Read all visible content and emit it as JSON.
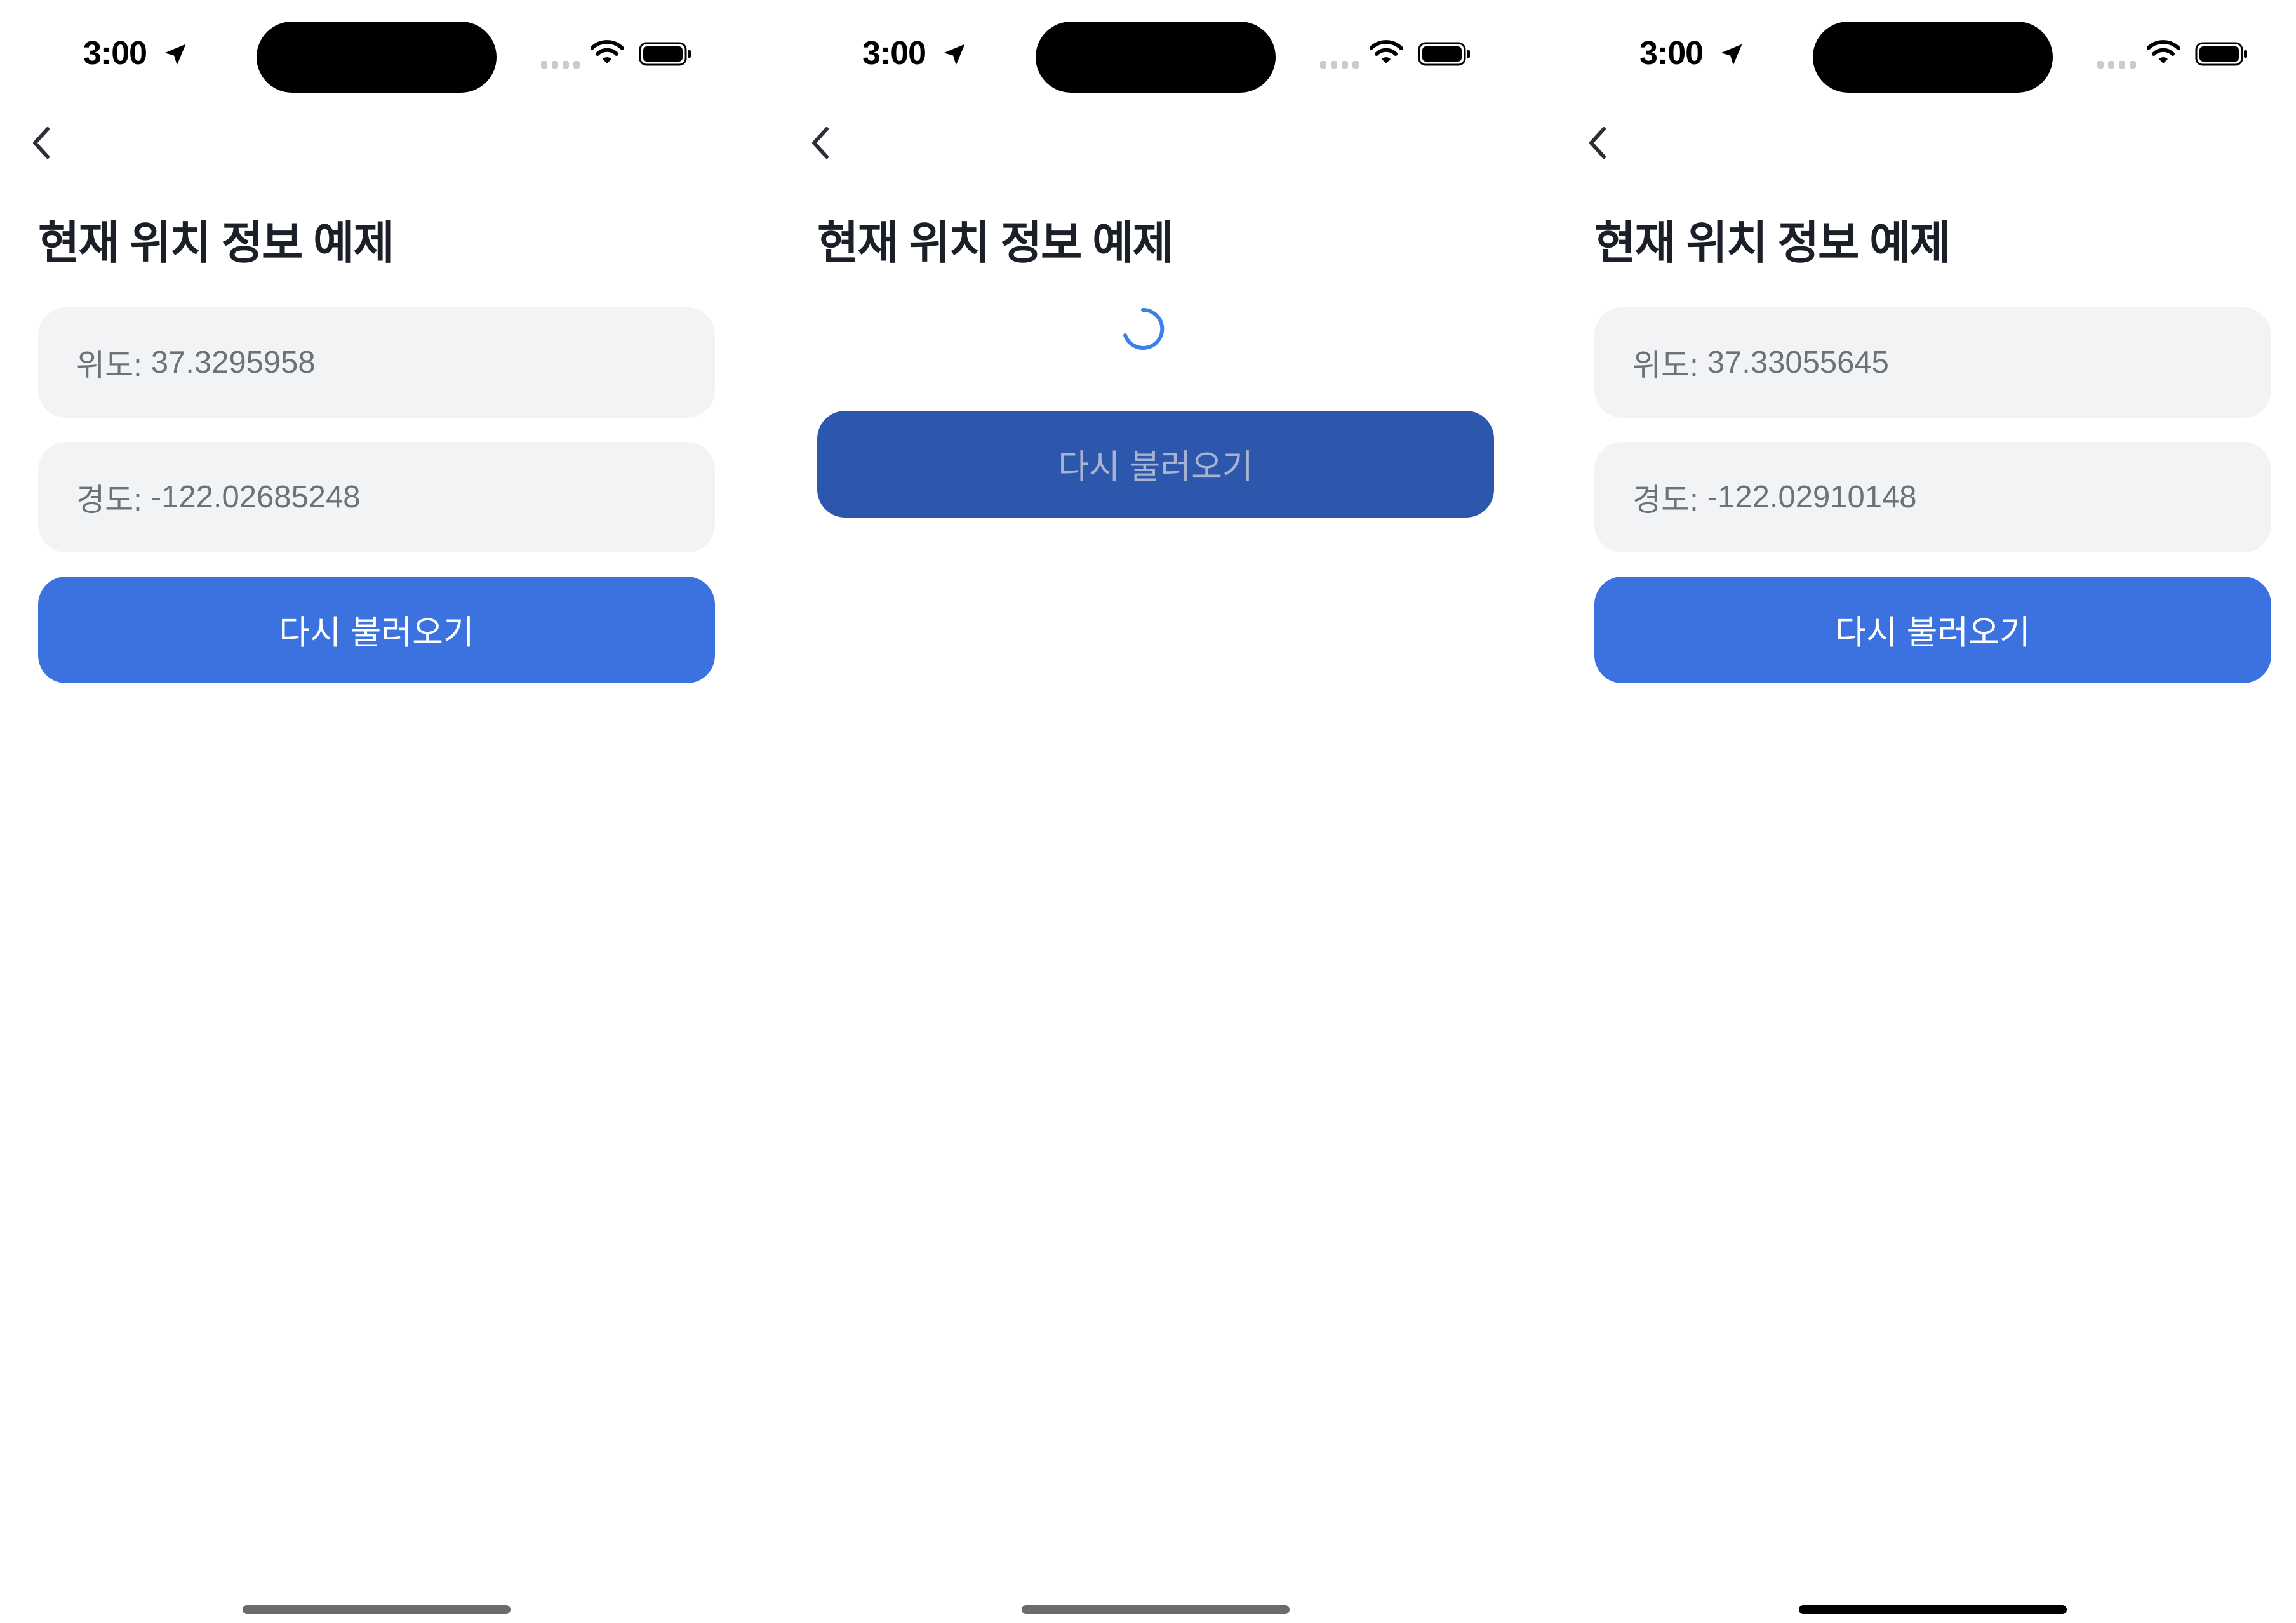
{
  "screens": [
    {
      "status": {
        "time": "3:00"
      },
      "title": "현재 위치 정보 예제",
      "latitude": {
        "label": "위도:",
        "value": "37.3295958"
      },
      "longitude": {
        "label": "경도:",
        "value": "-122.02685248"
      },
      "reload_label": "다시 불러오기"
    },
    {
      "status": {
        "time": "3:00"
      },
      "title": "현재 위치 정보 예제",
      "reload_label": "다시 불러오기"
    },
    {
      "status": {
        "time": "3:00"
      },
      "title": "현재 위치 정보 예제",
      "latitude": {
        "label": "위도:",
        "value": "37.33055645"
      },
      "longitude": {
        "label": "경도:",
        "value": "-122.02910148"
      },
      "reload_label": "다시 불러오기"
    }
  ],
  "icons": {
    "back": "chevron-left-icon",
    "location": "location-arrow-icon",
    "signal": "cellular-signal-icon",
    "wifi": "wifi-icon",
    "battery": "battery-icon",
    "loading": "spinner-icon"
  },
  "colors": {
    "accent": "#3c72e0",
    "accent_pressed": "#2d57ac",
    "field_bg": "#f2f3f5",
    "title_text": "#1b1f27",
    "field_text": "#6c717a",
    "spinner": "#3b82e8"
  }
}
